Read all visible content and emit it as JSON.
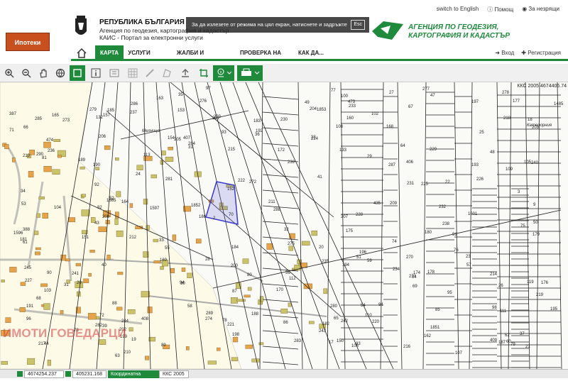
{
  "header": {
    "brand_logo_text": "Ипотеки",
    "republic_title": "РЕПУБЛИКА БЪЛГАРИЯ",
    "agency_subtitle": "Агенция по геодезия, картография и кадастър",
    "portal_subtitle": "КАИС - Портал за електронни услуги",
    "links": {
      "english": "switch to English",
      "help": "Помощ",
      "accessibility": "За незрящи"
    },
    "agency_logo_line1": "АГЕНЦИЯ ПО ГЕОДЕЗИЯ,",
    "agency_logo_line2": "КАРТОГРАФИЯ И КАДАСТЪР",
    "fullscreen_notice": "За да излезете от режима на цял екран, натиснете и задръжте",
    "esc_key": "Esc"
  },
  "nav": {
    "items": [
      "КАРТА",
      "УСЛУГИ",
      "ЖАЛБИ И ВЪЗРАЖЕНИЯ",
      "ПРОВЕРКА НА СТАТУС",
      "КАК ДА..."
    ],
    "login": "Вход",
    "register": "Регистрация"
  },
  "map": {
    "crs_readout": "ККС 2005 4674406.74",
    "watermark": "ИМОТИ ГОВЕДАРЦИ",
    "region_label_1": "Мелница",
    "region_label_2": "Катерорния",
    "parcels": [
      "31",
      "3",
      "29",
      "9",
      "2",
      "119",
      "28",
      "27",
      "26",
      "25",
      "24",
      "23",
      "22",
      "30",
      "31",
      "32",
      "33",
      "34",
      "35",
      "36",
      "37",
      "38",
      "39",
      "40",
      "41",
      "47",
      "44",
      "94",
      "17",
      "18",
      "19",
      "21",
      "43",
      "49",
      "52",
      "53",
      "50",
      "51",
      "48",
      "76",
      "83",
      "81",
      "80",
      "112",
      "111",
      "132",
      "133",
      "406",
      "407",
      "408",
      "409",
      "113",
      "162",
      "168",
      "169",
      "170",
      "172",
      "174",
      "178",
      "175",
      "176",
      "177",
      "152",
      "153",
      "154",
      "157",
      "165",
      "164",
      "163",
      "160",
      "387",
      "388",
      "1597",
      "1596",
      "1851",
      "1852",
      "1853",
      "1601",
      "1665",
      "1485",
      "20",
      "20",
      "54",
      "55",
      "56",
      "57",
      "58",
      "59",
      "60",
      "61",
      "62",
      "63",
      "64",
      "65",
      "66",
      "67",
      "68",
      "69",
      "70",
      "100",
      "102",
      "103",
      "150",
      "151",
      "290",
      "289",
      "288",
      "287",
      "286",
      "285",
      "284",
      "283",
      "282",
      "281",
      "280",
      "279",
      "278",
      "277",
      "276",
      "275",
      "274",
      "273",
      "272",
      "271",
      "270",
      "245",
      "244",
      "243",
      "242",
      "241",
      "240",
      "239",
      "238",
      "237",
      "236",
      "235",
      "234",
      "233",
      "232",
      "231",
      "230",
      "229",
      "228",
      "227",
      "226",
      "225",
      "224",
      "223",
      "222",
      "221",
      "220",
      "219",
      "218",
      "217",
      "216",
      "215",
      "214",
      "213",
      "212",
      "211",
      "210",
      "209",
      "208",
      "207",
      "206",
      "205",
      "204",
      "203",
      "202",
      "201",
      "200",
      "199",
      "198",
      "197",
      "196",
      "195",
      "194",
      "193",
      "192",
      "191",
      "190",
      "189",
      "188",
      "187",
      "186",
      "185",
      "184",
      "183",
      "182",
      "181",
      "180",
      "179",
      "474",
      "473",
      "435",
      "98",
      "97",
      "96",
      "95",
      "94",
      "93",
      "92",
      "91",
      "90",
      "89",
      "88",
      "87",
      "86",
      "85",
      "84",
      "82",
      "79",
      "78",
      "77",
      "75",
      "74",
      "73",
      "72",
      "71",
      "104",
      "105",
      "106",
      "107",
      "108",
      "109",
      "110"
    ]
  },
  "statusbar": {
    "coord_x": "4674254.237",
    "coord_y": "405231.168",
    "crs_label": "Координатна система",
    "crs_value": "ККС 2005"
  },
  "colors": {
    "accent": "#1f8a3c",
    "selection": "#3a3acc",
    "parcel_line": "#222222"
  }
}
